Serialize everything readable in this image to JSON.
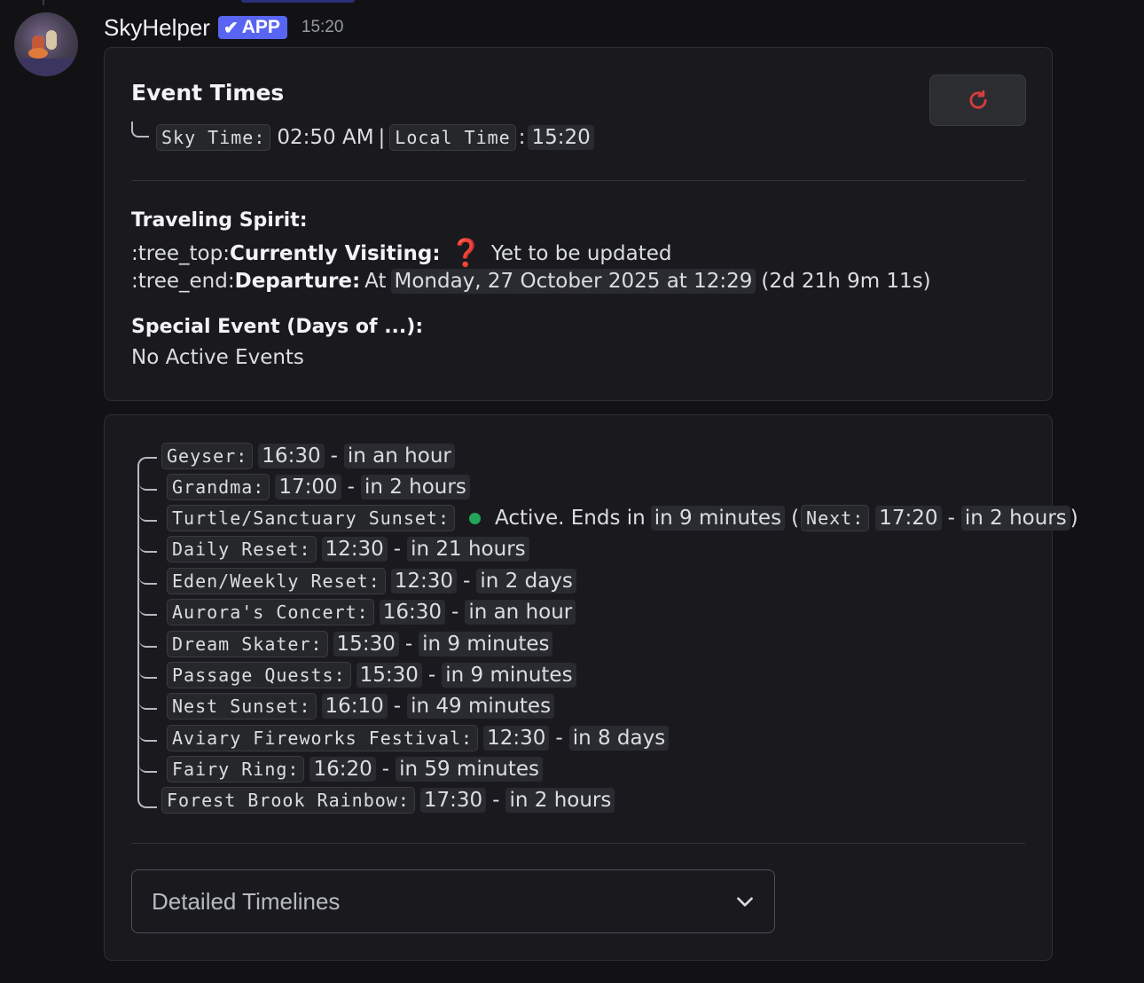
{
  "message": {
    "username": "SkyHelper",
    "badge": "APP",
    "timestamp": "15:20"
  },
  "event_times": {
    "title": "Event Times",
    "sky_time_label": "Sky Time:",
    "sky_time_value": "02:50 AM",
    "separator": "|",
    "local_time_label": "Local Time",
    "local_time_value": "15:20"
  },
  "traveling_spirit": {
    "heading": "Traveling Spirit:",
    "tree_top": ":tree_top:",
    "visiting_label": "Currently Visiting:",
    "visiting_value": "Yet to be updated",
    "tree_end": ":tree_end:",
    "departure_label": "Departure:",
    "departure_prefix": "At",
    "departure_date": "Monday, 27 October 2025 at 12:29",
    "departure_remaining": "(2d 21h 9m 11s)"
  },
  "special_event": {
    "heading": "Special Event (Days of ...):",
    "value": "No Active Events"
  },
  "events": [
    {
      "label": "Geyser:",
      "time": "16:30",
      "relative": "in an hour"
    },
    {
      "label": "Grandma:",
      "time": "17:00",
      "relative": "in 2 hours"
    },
    {
      "label": "Turtle/Sanctuary Sunset:",
      "status": "Active. Ends in",
      "ends": "in 9 minutes",
      "next_label": "Next:",
      "next_time": "17:20",
      "next_relative": "in 2 hours"
    },
    {
      "label": "Daily Reset:",
      "time": "12:30",
      "relative": "in 21 hours"
    },
    {
      "label": "Eden/Weekly Reset:",
      "time": "12:30",
      "relative": "in 2 days"
    },
    {
      "label": "Aurora's Concert:",
      "time": "16:30",
      "relative": "in an hour"
    },
    {
      "label": "Dream Skater:",
      "time": "15:30",
      "relative": "in 9 minutes"
    },
    {
      "label": "Passage Quests:",
      "time": "15:30",
      "relative": "in 9 minutes"
    },
    {
      "label": "Nest Sunset:",
      "time": "16:10",
      "relative": "in 49 minutes"
    },
    {
      "label": "Aviary Fireworks Festival:",
      "time": "12:30",
      "relative": "in 8 days"
    },
    {
      "label": "Fairy Ring:",
      "time": "16:20",
      "relative": "in 59 minutes"
    },
    {
      "label": "Forest Brook Rainbow:",
      "time": "17:30",
      "relative": "in 2 hours"
    }
  ],
  "dropdown": {
    "placeholder": "Detailed Timelines"
  },
  "colors": {
    "background": "#121214",
    "card": "#1a1a1e",
    "badge": "#5865f2",
    "refresh_icon": "#d83c3e",
    "active_dot": "#23a55a"
  },
  "icons": {
    "refresh": "refresh-icon",
    "question": "question-mark-icon",
    "chevron": "chevron-down-icon",
    "check": "check-icon"
  }
}
